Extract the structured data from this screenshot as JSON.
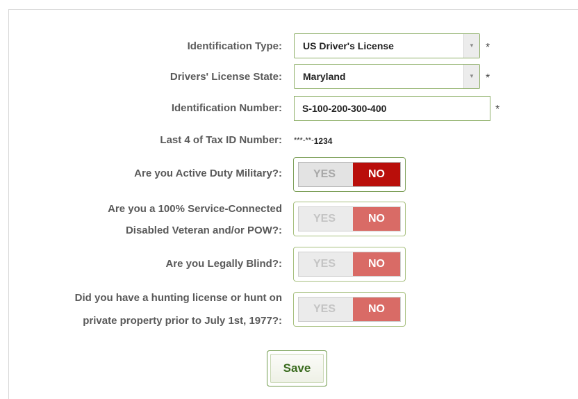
{
  "form": {
    "id_type": {
      "label": "Identification Type:",
      "value": "US Driver's License"
    },
    "license_state": {
      "label": "Drivers' License State:",
      "value": "Maryland"
    },
    "id_number": {
      "label": "Identification Number:",
      "value": "S-100-200-300-400"
    },
    "tax_id": {
      "label": "Last 4 of Tax ID Number:",
      "mask": "***-**-",
      "last4": "1234"
    },
    "required_marker": "*",
    "questions": [
      {
        "label_lines": [
          "Are you Active Duty Military?:"
        ],
        "yes": "YES",
        "no": "NO",
        "selected": "NO",
        "focused": true
      },
      {
        "label_lines": [
          "Are you a 100% Service-Connected",
          "Disabled Veteran and/or POW?:"
        ],
        "yes": "YES",
        "no": "NO",
        "selected": "NO",
        "focused": false
      },
      {
        "label_lines": [
          "Are you Legally Blind?:"
        ],
        "yes": "YES",
        "no": "NO",
        "selected": "NO",
        "focused": false
      },
      {
        "label_lines": [
          "Did you have a hunting license or hunt on",
          "private property prior to July 1st, 1977?:"
        ],
        "yes": "YES",
        "no": "NO",
        "selected": "NO",
        "focused": false
      }
    ],
    "save_label": "Save"
  },
  "colors": {
    "accent_border": "#8fb06a",
    "no_selected_active": "#b90e0a",
    "no_selected_inactive": "#d96b66",
    "save_text": "#3a6b1e"
  },
  "icons": {
    "select_arrow": "dropdown-arrow-icon"
  }
}
